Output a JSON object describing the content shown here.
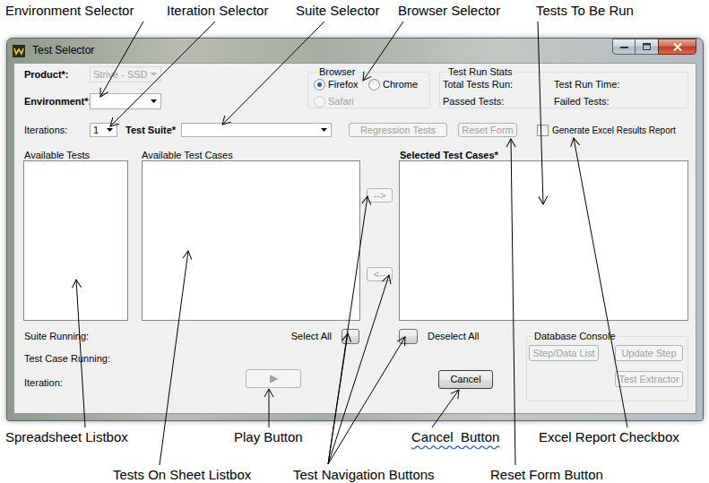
{
  "annotations": {
    "top": [
      {
        "text": "Environment Selector",
        "flagged": false
      },
      {
        "text": "Iteration Selector",
        "flagged": false
      },
      {
        "text": "Suite Selector",
        "flagged": false
      },
      {
        "text": "Browser Selector",
        "flagged": false
      },
      {
        "text": "Tests To Be Run",
        "flagged": false
      }
    ],
    "bottom": [
      {
        "text": "Spreadsheet Listbox",
        "flagged": false
      },
      {
        "text": "Play Button",
        "flagged": false
      },
      {
        "text": "Cancel  Button",
        "flagged": true
      },
      {
        "text": "Excel Report Checkbox",
        "flagged": false
      },
      {
        "text": "Tests On Sheet Listbox",
        "flagged": false
      },
      {
        "text": "Test Navigation Buttons",
        "flagged": false
      },
      {
        "text": "Reset Form Button",
        "flagged": false
      }
    ]
  },
  "window": {
    "title": "Test Selector"
  },
  "product": {
    "label": "Product*:",
    "value": "Strive - SSD",
    "disabled": true
  },
  "environment": {
    "label": "Environment*:",
    "value": "",
    "disabled": false
  },
  "browser": {
    "label": "Browser",
    "options": [
      {
        "label": "Firefox",
        "selected": true,
        "disabled": false
      },
      {
        "label": "Chrome",
        "selected": false,
        "disabled": false
      },
      {
        "label": "Safari",
        "selected": false,
        "disabled": true
      }
    ]
  },
  "test_run_stats": {
    "label": "Test Run Stats",
    "items": [
      "Total Tests Run:",
      "Test Run Time:",
      "Passed Tests:",
      "Failed Tests:"
    ]
  },
  "iterations": {
    "label": "Iterations:",
    "value": "1"
  },
  "test_suite": {
    "label": "Test Suite*",
    "value": ""
  },
  "regression_button": {
    "label": "Regression Tests",
    "disabled": true
  },
  "reset_button": {
    "label": "Reset Form",
    "disabled": true
  },
  "excel_report": {
    "label": "Generate Excel Results Report",
    "checked": false
  },
  "lists": [
    {
      "label": "Available Tests",
      "bold": false,
      "items": []
    },
    {
      "label": "Available Test Cases",
      "bold": false,
      "items": []
    },
    {
      "label": "Selected Test Cases*",
      "bold": true,
      "items": []
    }
  ],
  "nav_buttons": [
    {
      "label": "-->",
      "disabled": true
    },
    {
      "label": "<--",
      "disabled": true
    }
  ],
  "select_all": {
    "label": "Select All"
  },
  "deselect_all": {
    "label": "Deselect All"
  },
  "status": [
    "Suite Running:",
    "Test Case Running:",
    "Iteration:"
  ],
  "play_button": {
    "label": "▶",
    "disabled": true
  },
  "cancel_button": {
    "label": "Cancel",
    "disabled": false
  },
  "database_console": {
    "label": "Database Console",
    "buttons": [
      {
        "label": "Step/Data List",
        "disabled": true
      },
      {
        "label": "Update Step",
        "disabled": true
      },
      {
        "label": "Test Extractor",
        "disabled": true
      }
    ]
  }
}
